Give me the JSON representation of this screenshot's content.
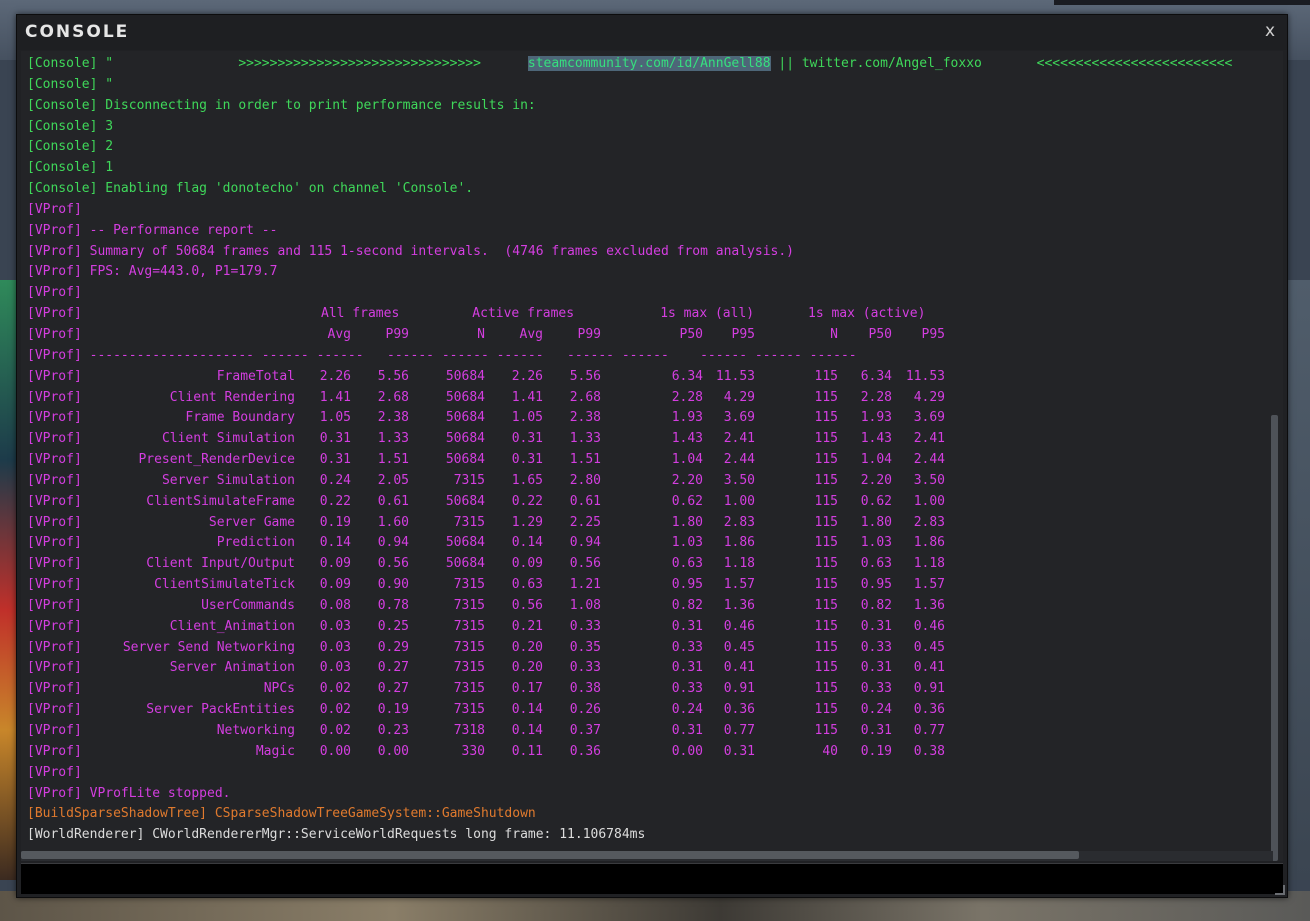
{
  "window": {
    "title": "CONSOLE",
    "close_label": "x"
  },
  "log": [
    {
      "color": "green",
      "segments": [
        {
          "text": "[Console] \"                >>>>>>>>>>>>>>>>>>>>>>>>>>>>>>>      "
        },
        {
          "text": "steamcommunity.com/id/AnnGell88",
          "selected": true
        },
        {
          "text": " || twitter.com/Angel_foxxo       <<<<<<<<<<<<<<<<<<<<<<<<<"
        }
      ]
    },
    {
      "color": "green",
      "segments": [
        {
          "text": "[Console] \""
        }
      ]
    },
    {
      "color": "green",
      "segments": [
        {
          "text": "[Console] Disconnecting in order to print performance results in:"
        }
      ]
    },
    {
      "color": "green",
      "segments": [
        {
          "text": "[Console] 3"
        }
      ]
    },
    {
      "color": "green",
      "segments": [
        {
          "text": "[Console] 2"
        }
      ]
    },
    {
      "color": "green",
      "segments": [
        {
          "text": "[Console] 1"
        }
      ]
    },
    {
      "color": "green",
      "segments": [
        {
          "text": "[Console] Enabling flag 'donotecho' on channel 'Console'."
        }
      ]
    },
    {
      "color": "magenta",
      "segments": [
        {
          "text": "[VProf]"
        }
      ]
    },
    {
      "color": "magenta",
      "segments": [
        {
          "text": "[VProf] -- Performance report --"
        }
      ]
    },
    {
      "color": "magenta",
      "segments": [
        {
          "text": "[VProf] Summary of 50684 frames and 115 1-second intervals.  (4746 frames excluded from analysis.)"
        }
      ]
    },
    {
      "color": "magenta",
      "segments": [
        {
          "text": "[VProf] FPS: Avg=443.0, P1=179.7"
        }
      ]
    },
    {
      "color": "magenta",
      "segments": [
        {
          "text": "[VProf]"
        }
      ]
    }
  ],
  "report": {
    "tag": "[VProf]",
    "group_headers": [
      "All frames",
      "Active frames",
      "1s max (all)",
      "1s max (active)"
    ],
    "columns": [
      "Avg",
      "P99",
      "N",
      "Avg",
      "P99",
      "P50",
      "P95",
      "N",
      "P50",
      "P95"
    ],
    "separator": "[VProf] --------------------- ------ ------   ------ ------ ------   ------ ------    ------ ------ ------",
    "rows": [
      {
        "name": "FrameTotal",
        "v": [
          "2.26",
          "5.56",
          "50684",
          "2.26",
          "5.56",
          "6.34",
          "11.53",
          "115",
          "6.34",
          "11.53"
        ]
      },
      {
        "name": "Client Rendering",
        "v": [
          "1.41",
          "2.68",
          "50684",
          "1.41",
          "2.68",
          "2.28",
          "4.29",
          "115",
          "2.28",
          "4.29"
        ]
      },
      {
        "name": "Frame Boundary",
        "v": [
          "1.05",
          "2.38",
          "50684",
          "1.05",
          "2.38",
          "1.93",
          "3.69",
          "115",
          "1.93",
          "3.69"
        ]
      },
      {
        "name": "Client Simulation",
        "v": [
          "0.31",
          "1.33",
          "50684",
          "0.31",
          "1.33",
          "1.43",
          "2.41",
          "115",
          "1.43",
          "2.41"
        ]
      },
      {
        "name": "Present_RenderDevice",
        "v": [
          "0.31",
          "1.51",
          "50684",
          "0.31",
          "1.51",
          "1.04",
          "2.44",
          "115",
          "1.04",
          "2.44"
        ]
      },
      {
        "name": "Server Simulation",
        "v": [
          "0.24",
          "2.05",
          "7315",
          "1.65",
          "2.80",
          "2.20",
          "3.50",
          "115",
          "2.20",
          "3.50"
        ]
      },
      {
        "name": "ClientSimulateFrame",
        "v": [
          "0.22",
          "0.61",
          "50684",
          "0.22",
          "0.61",
          "0.62",
          "1.00",
          "115",
          "0.62",
          "1.00"
        ]
      },
      {
        "name": "Server Game",
        "v": [
          "0.19",
          "1.60",
          "7315",
          "1.29",
          "2.25",
          "1.80",
          "2.83",
          "115",
          "1.80",
          "2.83"
        ]
      },
      {
        "name": "Prediction",
        "v": [
          "0.14",
          "0.94",
          "50684",
          "0.14",
          "0.94",
          "1.03",
          "1.86",
          "115",
          "1.03",
          "1.86"
        ]
      },
      {
        "name": "Client Input/Output",
        "v": [
          "0.09",
          "0.56",
          "50684",
          "0.09",
          "0.56",
          "0.63",
          "1.18",
          "115",
          "0.63",
          "1.18"
        ]
      },
      {
        "name": "ClientSimulateTick",
        "v": [
          "0.09",
          "0.90",
          "7315",
          "0.63",
          "1.21",
          "0.95",
          "1.57",
          "115",
          "0.95",
          "1.57"
        ]
      },
      {
        "name": "UserCommands",
        "v": [
          "0.08",
          "0.78",
          "7315",
          "0.56",
          "1.08",
          "0.82",
          "1.36",
          "115",
          "0.82",
          "1.36"
        ]
      },
      {
        "name": "Client_Animation",
        "v": [
          "0.03",
          "0.25",
          "7315",
          "0.21",
          "0.33",
          "0.31",
          "0.46",
          "115",
          "0.31",
          "0.46"
        ]
      },
      {
        "name": "Server Send Networking",
        "v": [
          "0.03",
          "0.29",
          "7315",
          "0.20",
          "0.35",
          "0.33",
          "0.45",
          "115",
          "0.33",
          "0.45"
        ]
      },
      {
        "name": "Server Animation",
        "v": [
          "0.03",
          "0.27",
          "7315",
          "0.20",
          "0.33",
          "0.31",
          "0.41",
          "115",
          "0.31",
          "0.41"
        ]
      },
      {
        "name": "NPCs",
        "v": [
          "0.02",
          "0.27",
          "7315",
          "0.17",
          "0.38",
          "0.33",
          "0.91",
          "115",
          "0.33",
          "0.91"
        ]
      },
      {
        "name": "Server PackEntities",
        "v": [
          "0.02",
          "0.19",
          "7315",
          "0.14",
          "0.26",
          "0.24",
          "0.36",
          "115",
          "0.24",
          "0.36"
        ]
      },
      {
        "name": "Networking",
        "v": [
          "0.02",
          "0.23",
          "7318",
          "0.14",
          "0.37",
          "0.31",
          "0.77",
          "115",
          "0.31",
          "0.77"
        ]
      },
      {
        "name": "Magic",
        "v": [
          "0.00",
          "0.00",
          "330",
          "0.11",
          "0.36",
          "0.00",
          "0.31",
          "40",
          "0.19",
          "0.38"
        ]
      }
    ]
  },
  "tail": [
    {
      "color": "magenta",
      "text": "[VProf]"
    },
    {
      "color": "magenta",
      "text": "[VProf] VProfLite stopped."
    },
    {
      "color": "orange",
      "text": "[BuildSparseShadowTree] CSparseShadowTreeGameSystem::GameShutdown"
    },
    {
      "color": "white",
      "text": "[WorldRenderer] CWorldRendererMgr::ServiceWorldRequests long frame: 11.106784ms"
    }
  ],
  "input": {
    "value": "",
    "placeholder": ""
  },
  "colors": {
    "green": "#3fd85a",
    "magenta": "#d43ee0",
    "orange": "#e07a2e",
    "white": "#dcdcdc",
    "selection": "#4d6678"
  }
}
